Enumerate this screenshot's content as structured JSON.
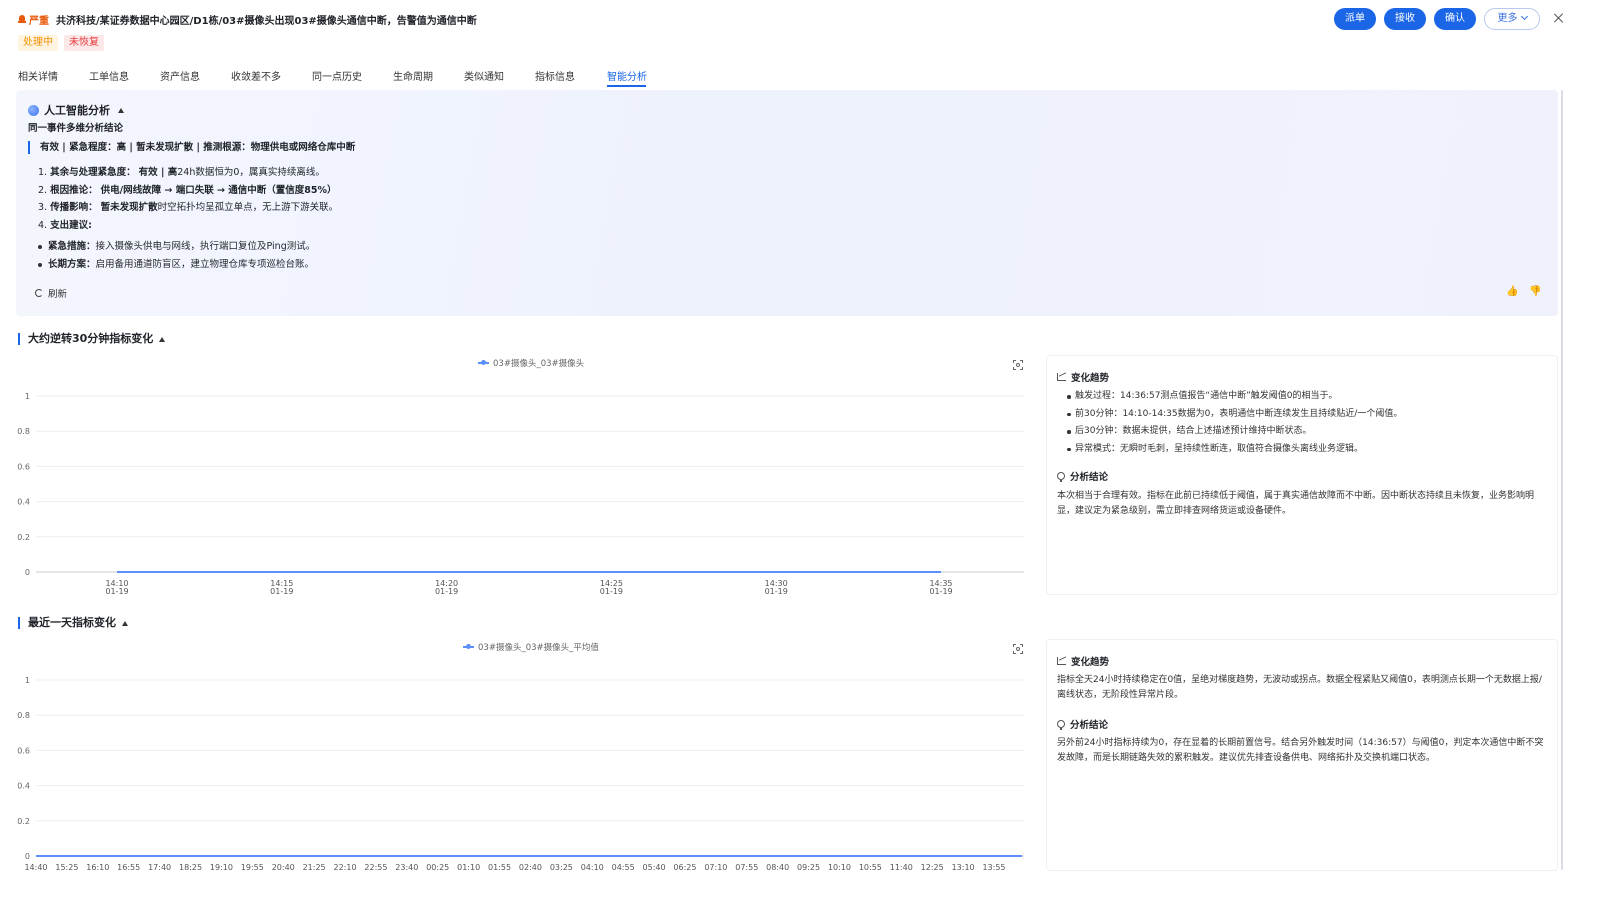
{
  "header": {
    "severity": "严重",
    "title": "共济科技/某证券数据中心园区/D1栋/03#摄像头出现03#摄像头通信中断，告警值为通信中断",
    "tags": [
      "处理中",
      "未恢复"
    ],
    "buttons": [
      "派单",
      "接收",
      "确认",
      "更多"
    ]
  },
  "tabs": [
    "相关详情",
    "工单信息",
    "资产信息",
    "收敛差不多",
    "同一点历史",
    "生命周期",
    "类似通知",
    "指标信息",
    "智能分析"
  ],
  "active_tab": "智能分析",
  "ai_panel": {
    "title": "人工智能分析",
    "subtitle": "同一事件多维分析结论",
    "conclusion": "有效 | 紧急程度：高 | 暂未发现扩散 | 推测根源：物理供电或网络仓库中断",
    "items": [
      {
        "num": "1.",
        "label": "其余与处理紧急度：",
        "bold": "有效 | 高",
        "text": "24h数据恒为0，属真实持续离线。"
      },
      {
        "num": "2.",
        "label": "根因推论：",
        "bold": "供电/网线故障 → 端口失联 → 通信中断（置信度85%）",
        "text": ""
      },
      {
        "num": "3.",
        "label": "传播影响：",
        "bold": "暂未发现扩散",
        "text": "时空拓扑均呈孤立单点，无上游下游关联。"
      },
      {
        "num": "4.",
        "label": "支出建议:",
        "bold": "",
        "text": ""
      }
    ],
    "bullets": [
      {
        "label": "紧急措施：",
        "text": "接入摄像头供电与网线，执行端口复位及Ping测试。"
      },
      {
        "label": "长期方案：",
        "text": "启用备用通道防盲区，建立物理仓库专项巡检台账。"
      }
    ],
    "refresh_label": "刷新",
    "thumb_up": "👍",
    "thumb_down": "👎"
  },
  "section1": {
    "title": "大约逆转30分钟指标变化",
    "side": {
      "trend_title": "变化趋势",
      "trend_items": [
        "触发过程：14:36:57测点值报告“通信中断”触发阈值0的相当于。",
        "前30分钟：14:10-14:35数据为0，表明通信中断连续发生且持续贴近/一个阈值。",
        "后30分钟：数据未提供，结合上述描述预计维持中断状态。",
        "异常模式：无瞬时毛刺，呈持续性断连，取值符合摄像头离线业务逻辑。"
      ],
      "conclusion_title": "分析结论",
      "conclusion_text": "本次相当于合理有效。指标在此前已持续低于阈值，属于真实通信故障而不中断。因中断状态持续且未恢复，业务影响明显，建议定为紧急级别，需立即排查网络货运或设备硬件。"
    }
  },
  "section2": {
    "title": "最近一天指标变化",
    "side": {
      "trend_title": "变化趋势",
      "trend_text": "指标全天24小时持续稳定在0值，呈绝对梯度趋势，无波动或拐点。数据全程紧贴又阈值0，表明测点长期一个无数据上报/离线状态，无阶段性异常片段。",
      "conclusion_title": "分析结论",
      "conclusion_text": "另外前24小时指标持续为0，存在显着的长期前置信号。结合另外触发时间（14:36:57）与阈值0，判定本次通信中断不突发故障，而是长期链路失效的累积触发。建议优先排查设备供电、网络拓扑及交换机端口状态。"
    }
  },
  "chart_data": [
    {
      "type": "line",
      "series": [
        {
          "name": "03#摄像头_03#摄像头",
          "values": [
            0,
            0,
            0,
            0,
            0,
            0
          ]
        }
      ],
      "x": [
        "14:10",
        "14:15",
        "14:20",
        "14:25",
        "14:30",
        "14:35"
      ],
      "x_sub": "01-19",
      "ylim": [
        0,
        1
      ],
      "yticks": [
        "0",
        "0.2",
        "0.4",
        "0.6",
        "0.8",
        "1"
      ],
      "grid": true,
      "legend": "top-center"
    },
    {
      "type": "line",
      "series": [
        {
          "name": "03#摄像头_03#摄像头_平均值",
          "values": [
            0,
            0,
            0,
            0,
            0,
            0,
            0,
            0,
            0,
            0,
            0,
            0,
            0,
            0,
            0,
            0,
            0,
            0,
            0,
            0,
            0,
            0,
            0,
            0,
            0,
            0,
            0,
            0,
            0,
            0,
            0,
            0,
            0
          ]
        }
      ],
      "x": [
        "14:40",
        "15:25",
        "16:10",
        "16:55",
        "17:40",
        "18:25",
        "19:10",
        "19:55",
        "20:40",
        "21:25",
        "22:10",
        "22:55",
        "23:40",
        "00:25",
        "01:10",
        "01:55",
        "02:40",
        "03:25",
        "04:10",
        "04:55",
        "05:40",
        "06:25",
        "07:10",
        "07:55",
        "08:40",
        "09:25",
        "10:10",
        "10:55",
        "11:40",
        "12:25",
        "13:10",
        "13:55"
      ],
      "ylim": [
        0,
        1
      ],
      "yticks": [
        "0",
        "0.2",
        "0.4",
        "0.6",
        "0.8",
        "1"
      ],
      "grid": true,
      "legend": "top-center"
    }
  ]
}
